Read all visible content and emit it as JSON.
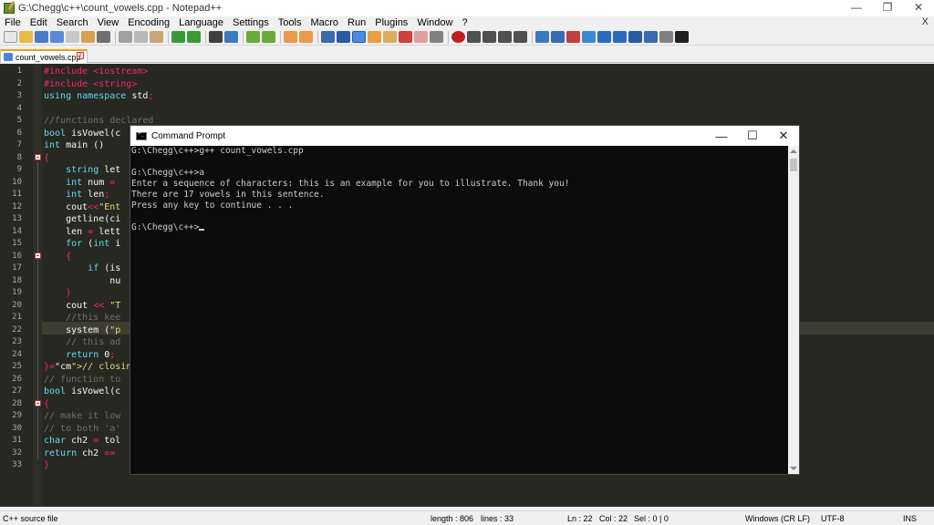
{
  "window": {
    "title": "G:\\Chegg\\c++\\count_vowels.cpp - Notepad++",
    "minimize": "—",
    "maximize": "❐",
    "close": "✕"
  },
  "menu": {
    "items": [
      "File",
      "Edit",
      "Search",
      "View",
      "Encoding",
      "Language",
      "Settings",
      "Tools",
      "Macro",
      "Run",
      "Plugins",
      "Window",
      "?"
    ],
    "close_doc": "X"
  },
  "tab": {
    "label": "count_vowels.cpp",
    "close": "x"
  },
  "editor": {
    "line_numbers": [
      "1",
      "2",
      "3",
      "4",
      "5",
      "6",
      "7",
      "8",
      "9",
      "10",
      "11",
      "12",
      "13",
      "14",
      "15",
      "16",
      "17",
      "18",
      "19",
      "20",
      "21",
      "22",
      "23",
      "24",
      "25",
      "26",
      "27",
      "28",
      "29",
      "30",
      "31",
      "32",
      "33"
    ],
    "lines": [
      "#include <iostream>",
      "#include <string>",
      "using namespace std;",
      "",
      "//functions declared",
      "bool isVowel(c",
      "int main ()",
      "{",
      "    string let",
      "    int num = ",
      "    int len;",
      "    cout<<\"Ent",
      "    getline(ci",
      "    len = lett",
      "    for (int i",
      "    {",
      "        if (is",
      "            nu",
      "    }",
      "    cout << \"T",
      "    //this kee",
      "    system (\"p",
      "    // this ad",
      "    return 0;",
      "}// closing ma",
      "// function to",
      "bool isVowel(c",
      "{",
      "// make it low",
      "// to both 'a'",
      "char ch2 = tol",
      "return ch2 == ",
      "}"
    ]
  },
  "cmd": {
    "title": "Command Prompt",
    "minimize": "—",
    "maximize": "☐",
    "close": "✕",
    "lines": [
      "G:\\Chegg\\c++>g++ count_vowels.cpp",
      "",
      "G:\\Chegg\\c++>a",
      "Enter a sequence of characters: this is an example for you to illustrate. Thank you!",
      "There are 17 vowels in this sentence.",
      "Press any key to continue . . .",
      "",
      "G:\\Chegg\\c++>"
    ]
  },
  "status": {
    "file_type": "C++ source file",
    "length": "length : 806",
    "lines": "lines : 33",
    "ln": "Ln : 22",
    "col": "Col : 22",
    "sel": "Sel : 0 | 0",
    "eol": "Windows (CR LF)",
    "encoding": "UTF-8",
    "mode": "INS"
  },
  "colors": {
    "editor_bg": "#272822",
    "cmd_bg": "#0c0c0c",
    "tab_accent": "#f3a018"
  }
}
